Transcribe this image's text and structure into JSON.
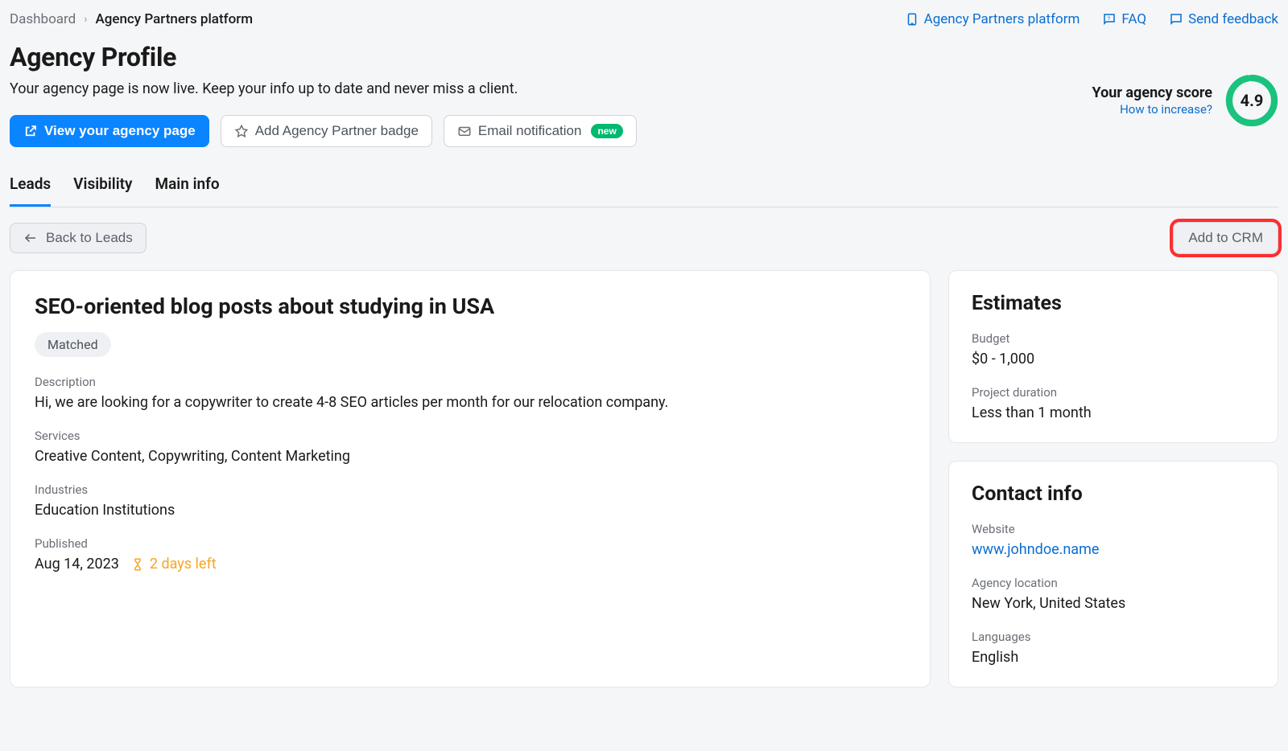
{
  "breadcrumb": {
    "root": "Dashboard",
    "current": "Agency Partners platform"
  },
  "toplinks": {
    "platform": "Agency Partners platform",
    "faq": "FAQ",
    "feedback": "Send feedback"
  },
  "header": {
    "title": "Agency Profile",
    "subtitle": "Your agency page is now live. Keep your info up to date and never miss a client."
  },
  "buttons": {
    "view_page": "View your agency page",
    "add_badge": "Add Agency Partner badge",
    "email_notif": "Email notification",
    "email_badge": "new"
  },
  "score": {
    "label": "Your agency score",
    "link": "How to increase?",
    "value": "4.9"
  },
  "tabs": {
    "leads": "Leads",
    "visibility": "Visibility",
    "main_info": "Main info"
  },
  "actions": {
    "back": "Back to Leads",
    "crm": "Add to CRM"
  },
  "lead": {
    "title": "SEO-oriented blog posts about studying in USA",
    "status": "Matched",
    "desc_label": "Description",
    "desc": "Hi, we are looking for a copywriter to create 4-8 SEO articles per month for our relocation company.",
    "services_label": "Services",
    "services": "Creative Content, Copywriting, Content Marketing",
    "industries_label": "Industries",
    "industries": "Education Institutions",
    "published_label": "Published",
    "published": "Aug 14, 2023",
    "days_left": "2 days left"
  },
  "estimates": {
    "title": "Estimates",
    "budget_label": "Budget",
    "budget": "$0 - 1,000",
    "duration_label": "Project duration",
    "duration": "Less than 1 month"
  },
  "contact": {
    "title": "Contact info",
    "website_label": "Website",
    "website": "www.johndoe.name",
    "location_label": "Agency location",
    "location": "New York, United States",
    "languages_label": "Languages",
    "languages": "English"
  }
}
